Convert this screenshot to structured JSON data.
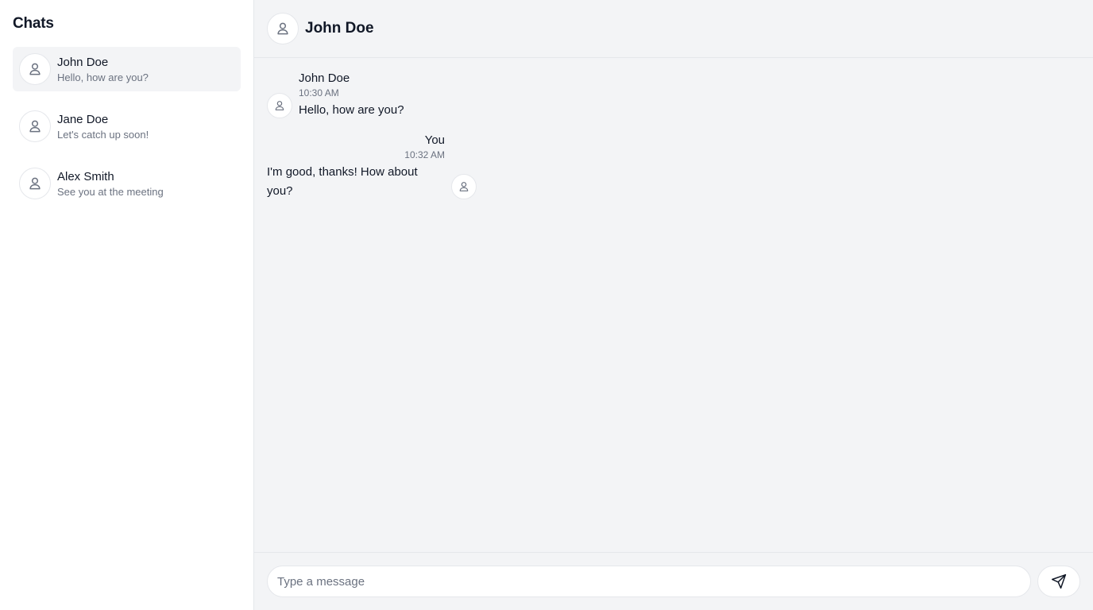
{
  "sidebar": {
    "title": "Chats",
    "items": [
      {
        "name": "John Doe",
        "preview": "Hello, how are you?",
        "active": true,
        "icon": "user-icon"
      },
      {
        "name": "Jane Doe",
        "preview": "Let's catch up soon!",
        "active": false,
        "icon": "user-icon"
      },
      {
        "name": "Alex Smith",
        "preview": "See you at the meeting",
        "active": false,
        "icon": "user-icon"
      }
    ]
  },
  "header": {
    "title": "John Doe",
    "icon": "user-icon"
  },
  "messages": [
    {
      "sender": "John Doe",
      "time": "10:30 AM",
      "text": "Hello, how are you?",
      "direction": "incoming"
    },
    {
      "sender": "You",
      "time": "10:32 AM",
      "text": "I'm good, thanks! How about you?",
      "direction": "outgoing"
    }
  ],
  "composer": {
    "placeholder": "Type a message",
    "value": "",
    "send_icon": "send-icon"
  },
  "colors": {
    "sidebar_bg": "#ffffff",
    "main_bg": "#f3f4f6",
    "active_item_bg": "#f3f4f6",
    "border": "#e5e7eb",
    "muted_text": "#6b7280",
    "text": "#111827"
  }
}
